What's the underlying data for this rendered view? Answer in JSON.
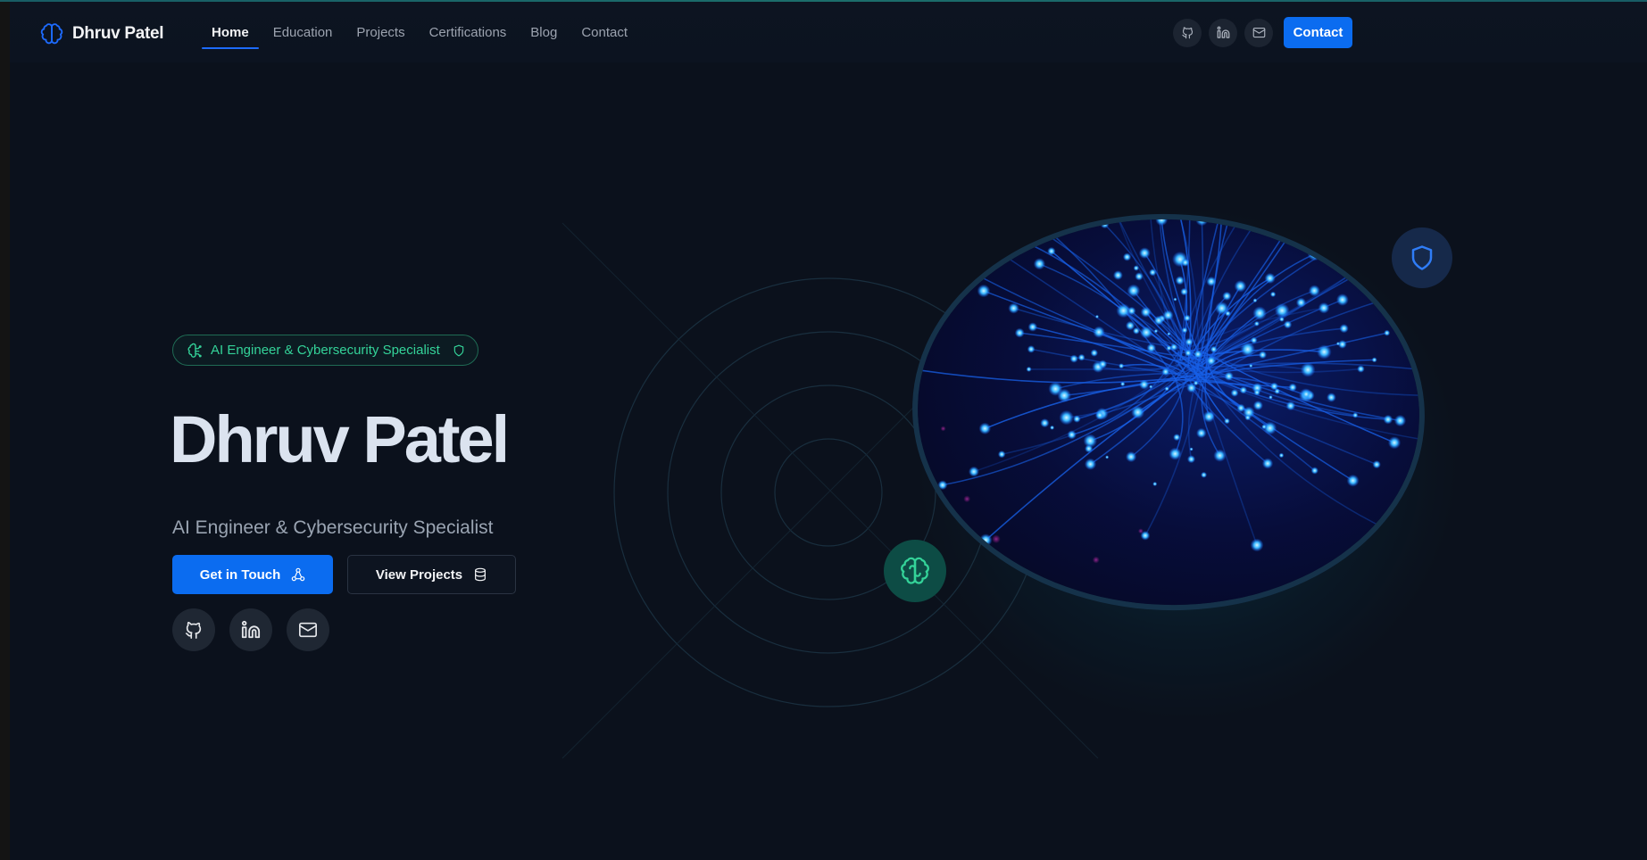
{
  "brand": {
    "name": "Dhruv Patel",
    "icon": "brain-icon"
  },
  "nav": {
    "links": [
      {
        "label": "Home",
        "active": true
      },
      {
        "label": "Education"
      },
      {
        "label": "Projects"
      },
      {
        "label": "Certifications"
      },
      {
        "label": "Blog"
      },
      {
        "label": "Contact"
      }
    ],
    "socials": [
      "github-icon",
      "linkedin-icon",
      "mail-icon"
    ],
    "cta_label": "Contact"
  },
  "hero": {
    "badge": "AI Engineer & Cybersecurity Specialist",
    "title": "Dhruv Patel",
    "subtitle": "AI Engineer & Cybersecurity Specialist",
    "primary_button": "Get in Touch",
    "secondary_button": "View Projects",
    "socials": [
      "github-icon",
      "linkedin-icon",
      "mail-icon"
    ]
  },
  "colors": {
    "accent": "#0b6cf0",
    "green": "#34d399",
    "background": "#0b111c"
  }
}
